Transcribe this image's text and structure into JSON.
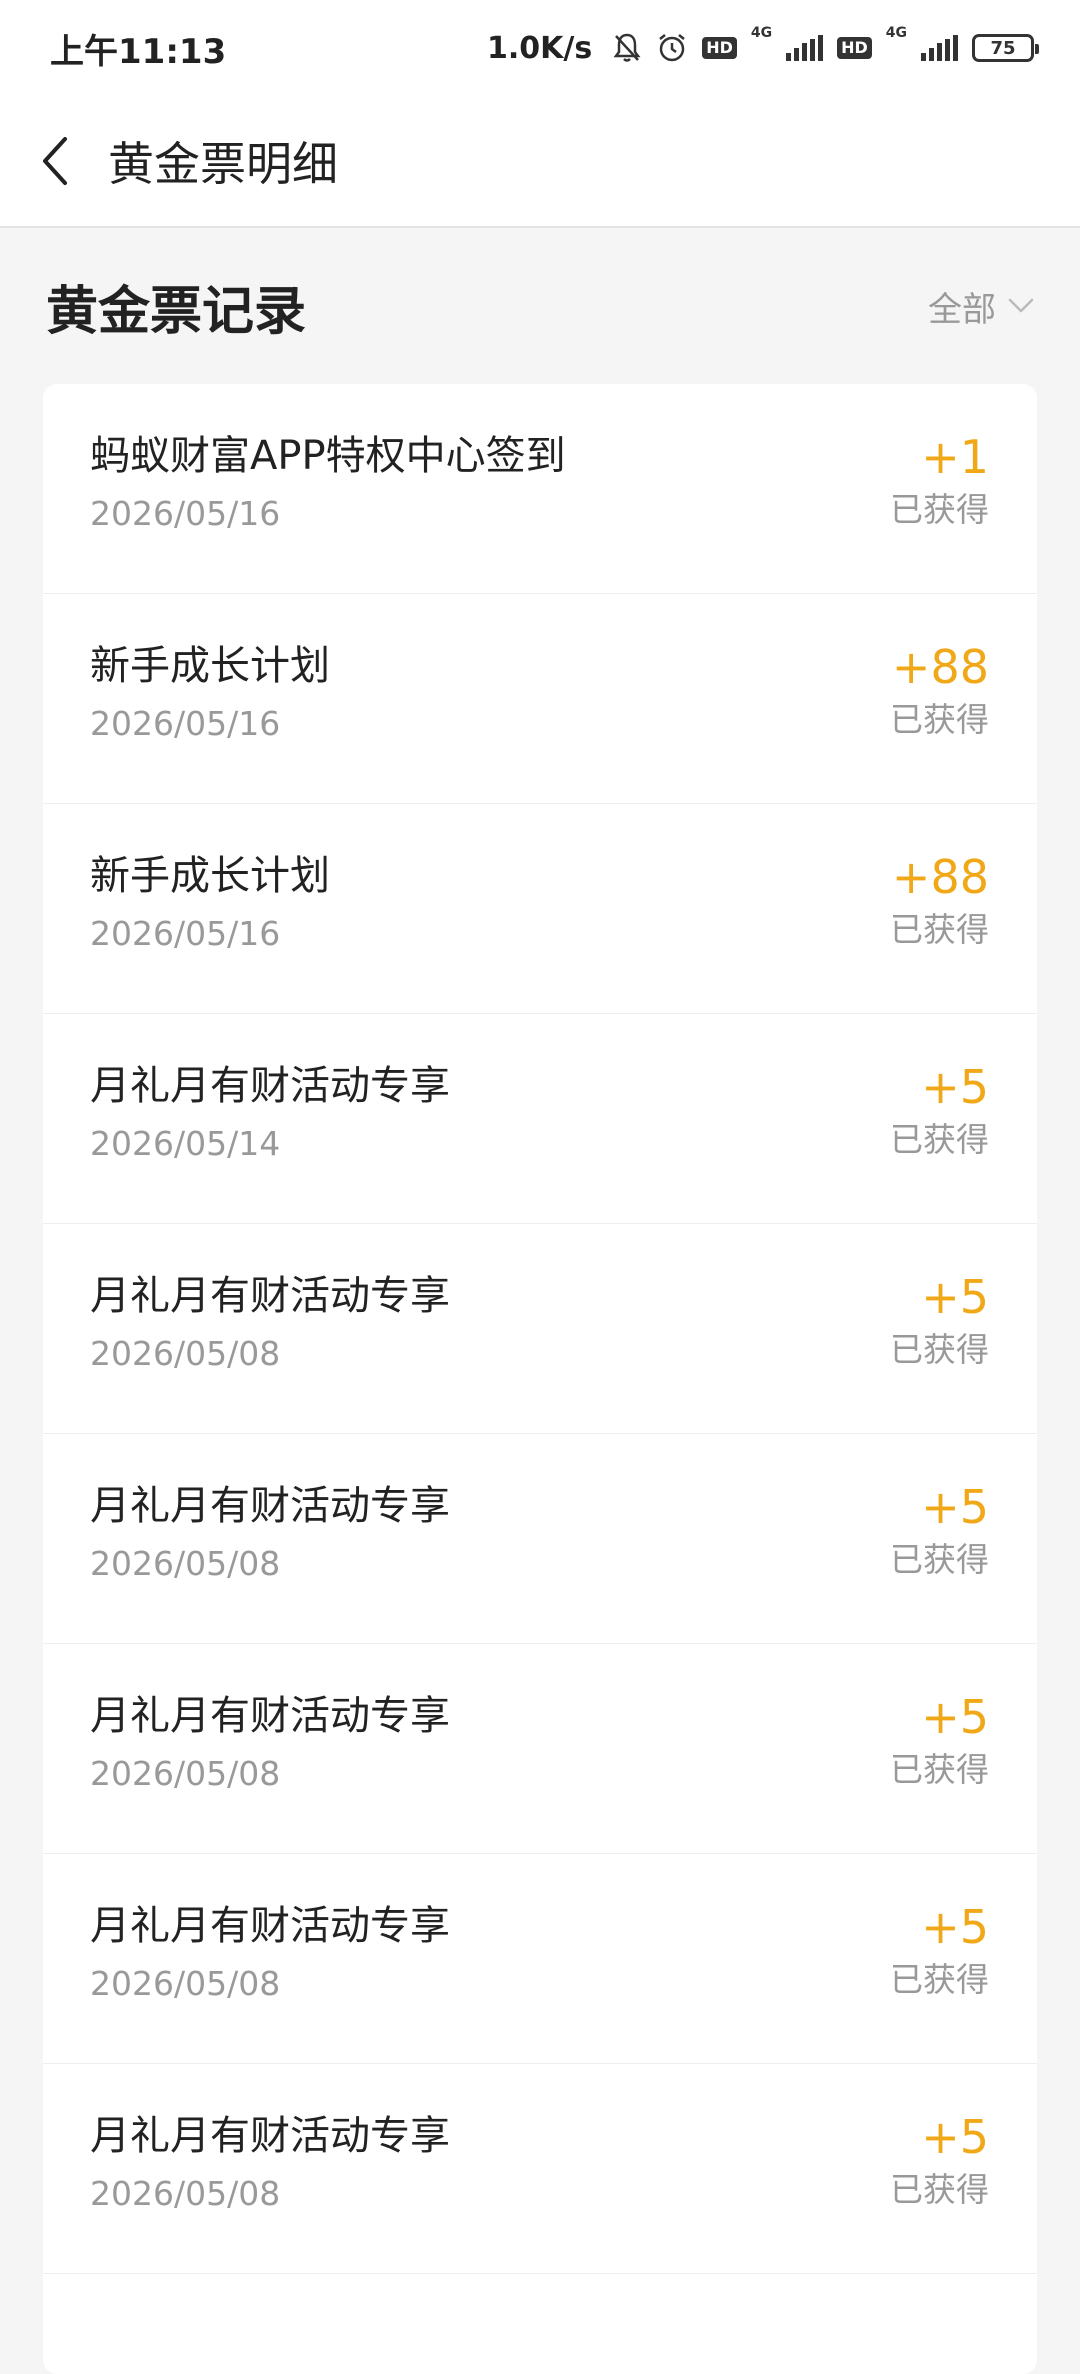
{
  "status_bar": {
    "time": "上午11:13",
    "net_speed": "1.0K/s",
    "icons": [
      "bell-off-icon",
      "alarm-icon",
      "hd-icon",
      "signal-4g-icon",
      "hd-icon",
      "signal-4g-icon",
      "battery-icon"
    ],
    "hd_label": "HD",
    "network_1": "4G",
    "network_2": "4G",
    "battery": "75"
  },
  "nav": {
    "title": "黄金票明细"
  },
  "section": {
    "title": "黄金票记录",
    "filter_label": "全部"
  },
  "colors": {
    "accent": "#f0a818",
    "background": "#f5f5f5",
    "card": "#ffffff"
  },
  "records": [
    {
      "title": "蚂蚁财富APP特权中心签到",
      "date": "2026/05/16",
      "amount": "+1",
      "status": "已获得"
    },
    {
      "title": "新手成长计划",
      "date": "2026/05/16",
      "amount": "+88",
      "status": "已获得"
    },
    {
      "title": "新手成长计划",
      "date": "2026/05/16",
      "amount": "+88",
      "status": "已获得"
    },
    {
      "title": "月礼月有财活动专享",
      "date": "2026/05/14",
      "amount": "+5",
      "status": "已获得"
    },
    {
      "title": "月礼月有财活动专享",
      "date": "2026/05/08",
      "amount": "+5",
      "status": "已获得"
    },
    {
      "title": "月礼月有财活动专享",
      "date": "2026/05/08",
      "amount": "+5",
      "status": "已获得"
    },
    {
      "title": "月礼月有财活动专享",
      "date": "2026/05/08",
      "amount": "+5",
      "status": "已获得"
    },
    {
      "title": "月礼月有财活动专享",
      "date": "2026/05/08",
      "amount": "+5",
      "status": "已获得"
    },
    {
      "title": "月礼月有财活动专享",
      "date": "2026/05/08",
      "amount": "+5",
      "status": "已获得"
    }
  ]
}
